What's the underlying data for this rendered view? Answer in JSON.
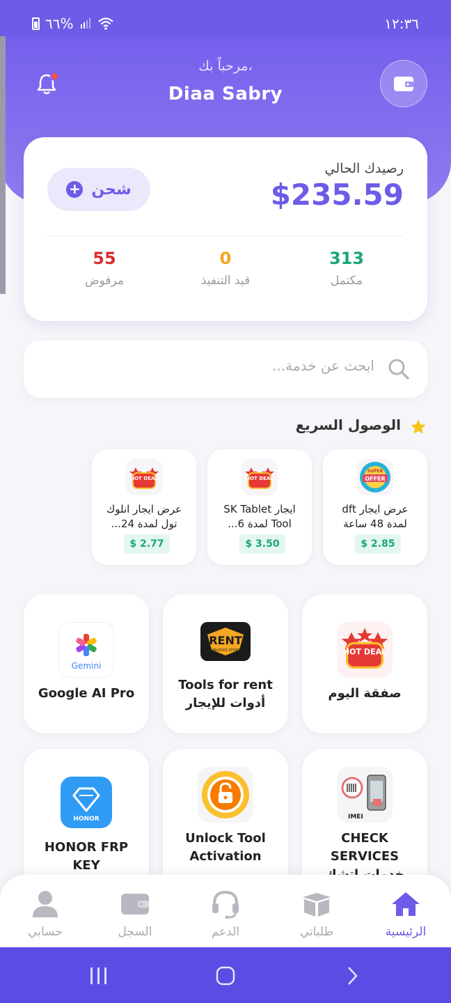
{
  "status_bar": {
    "time": "١٢:٣٦",
    "battery": "٦٦%"
  },
  "header": {
    "greeting": "مرحباً بك،",
    "username": "Diaa Sabry"
  },
  "balance_card": {
    "label": "رصيدك الحالي",
    "value": "$235.59",
    "charge_label": "شحن",
    "stats": [
      {
        "value": "313",
        "label": "مكتمل",
        "color": "#1aa57a"
      },
      {
        "value": "0",
        "label": "قيد التنفيذ",
        "color": "#f5a623"
      },
      {
        "value": "55",
        "label": "مرفوض",
        "color": "#d63031"
      }
    ]
  },
  "search": {
    "placeholder": "ابحث عن خدمة..."
  },
  "quick_access": {
    "title": "الوصول السريع",
    "items": [
      {
        "name_line1": "عرض ايجار dft",
        "name_line2": "لمدة 48 ساعة",
        "price": "$ 2.85",
        "thumb": "offer-badge-icon"
      },
      {
        "name_line1": "ايجار SK Tablet",
        "name_line2": "Tool لمدة 6...",
        "price": "$ 3.50",
        "thumb": "hot-deal-icon"
      },
      {
        "name_line1": "عرض ايجار انلوك",
        "name_line2": "تول لمدة 24...",
        "price": "$ 2.77",
        "thumb": "hot-deal-icon"
      }
    ]
  },
  "services": [
    {
      "line1": "صفقة اليوم",
      "line2": "",
      "icon": "hot-deal-icon"
    },
    {
      "line1": "Tools for rent",
      "line2": "أدوات للإيجار",
      "icon": "rent-unlocks-store-icon"
    },
    {
      "line1": "Google AI Pro",
      "line2": "",
      "icon": "gemini-icon"
    },
    {
      "line1": "CHECK SERVICES",
      "line2": "خدمات اتشك",
      "icon": "imei-check-icon"
    },
    {
      "line1": "Unlock Tool",
      "line2": "Activation",
      "icon": "unlock-tool-icon"
    },
    {
      "line1": "HONOR FRP KEY",
      "line2": "",
      "icon": "honor-icon"
    }
  ],
  "logos": {
    "hot_deal": "HOT DEAL",
    "offer_top": "SUPER",
    "offer": "OFFER",
    "rent": "RENT",
    "rent_sub": "UNLOCKS STORE",
    "gemini": "Gemini",
    "imei": "IMEI",
    "honor": "HONOR"
  },
  "bottom_nav": [
    {
      "label": "الرئيسية",
      "icon": "home-icon",
      "active": true
    },
    {
      "label": "طلباتي",
      "icon": "box-icon",
      "active": false
    },
    {
      "label": "الدعم",
      "icon": "headset-icon",
      "active": false
    },
    {
      "label": "السجل",
      "icon": "wallet-icon",
      "active": false
    },
    {
      "label": "حسابي",
      "icon": "user-icon",
      "active": false
    }
  ],
  "colors": {
    "accent": "#6c5ce7",
    "success": "#1aa57a",
    "pending": "#f5a623",
    "rejected": "#d63031"
  }
}
